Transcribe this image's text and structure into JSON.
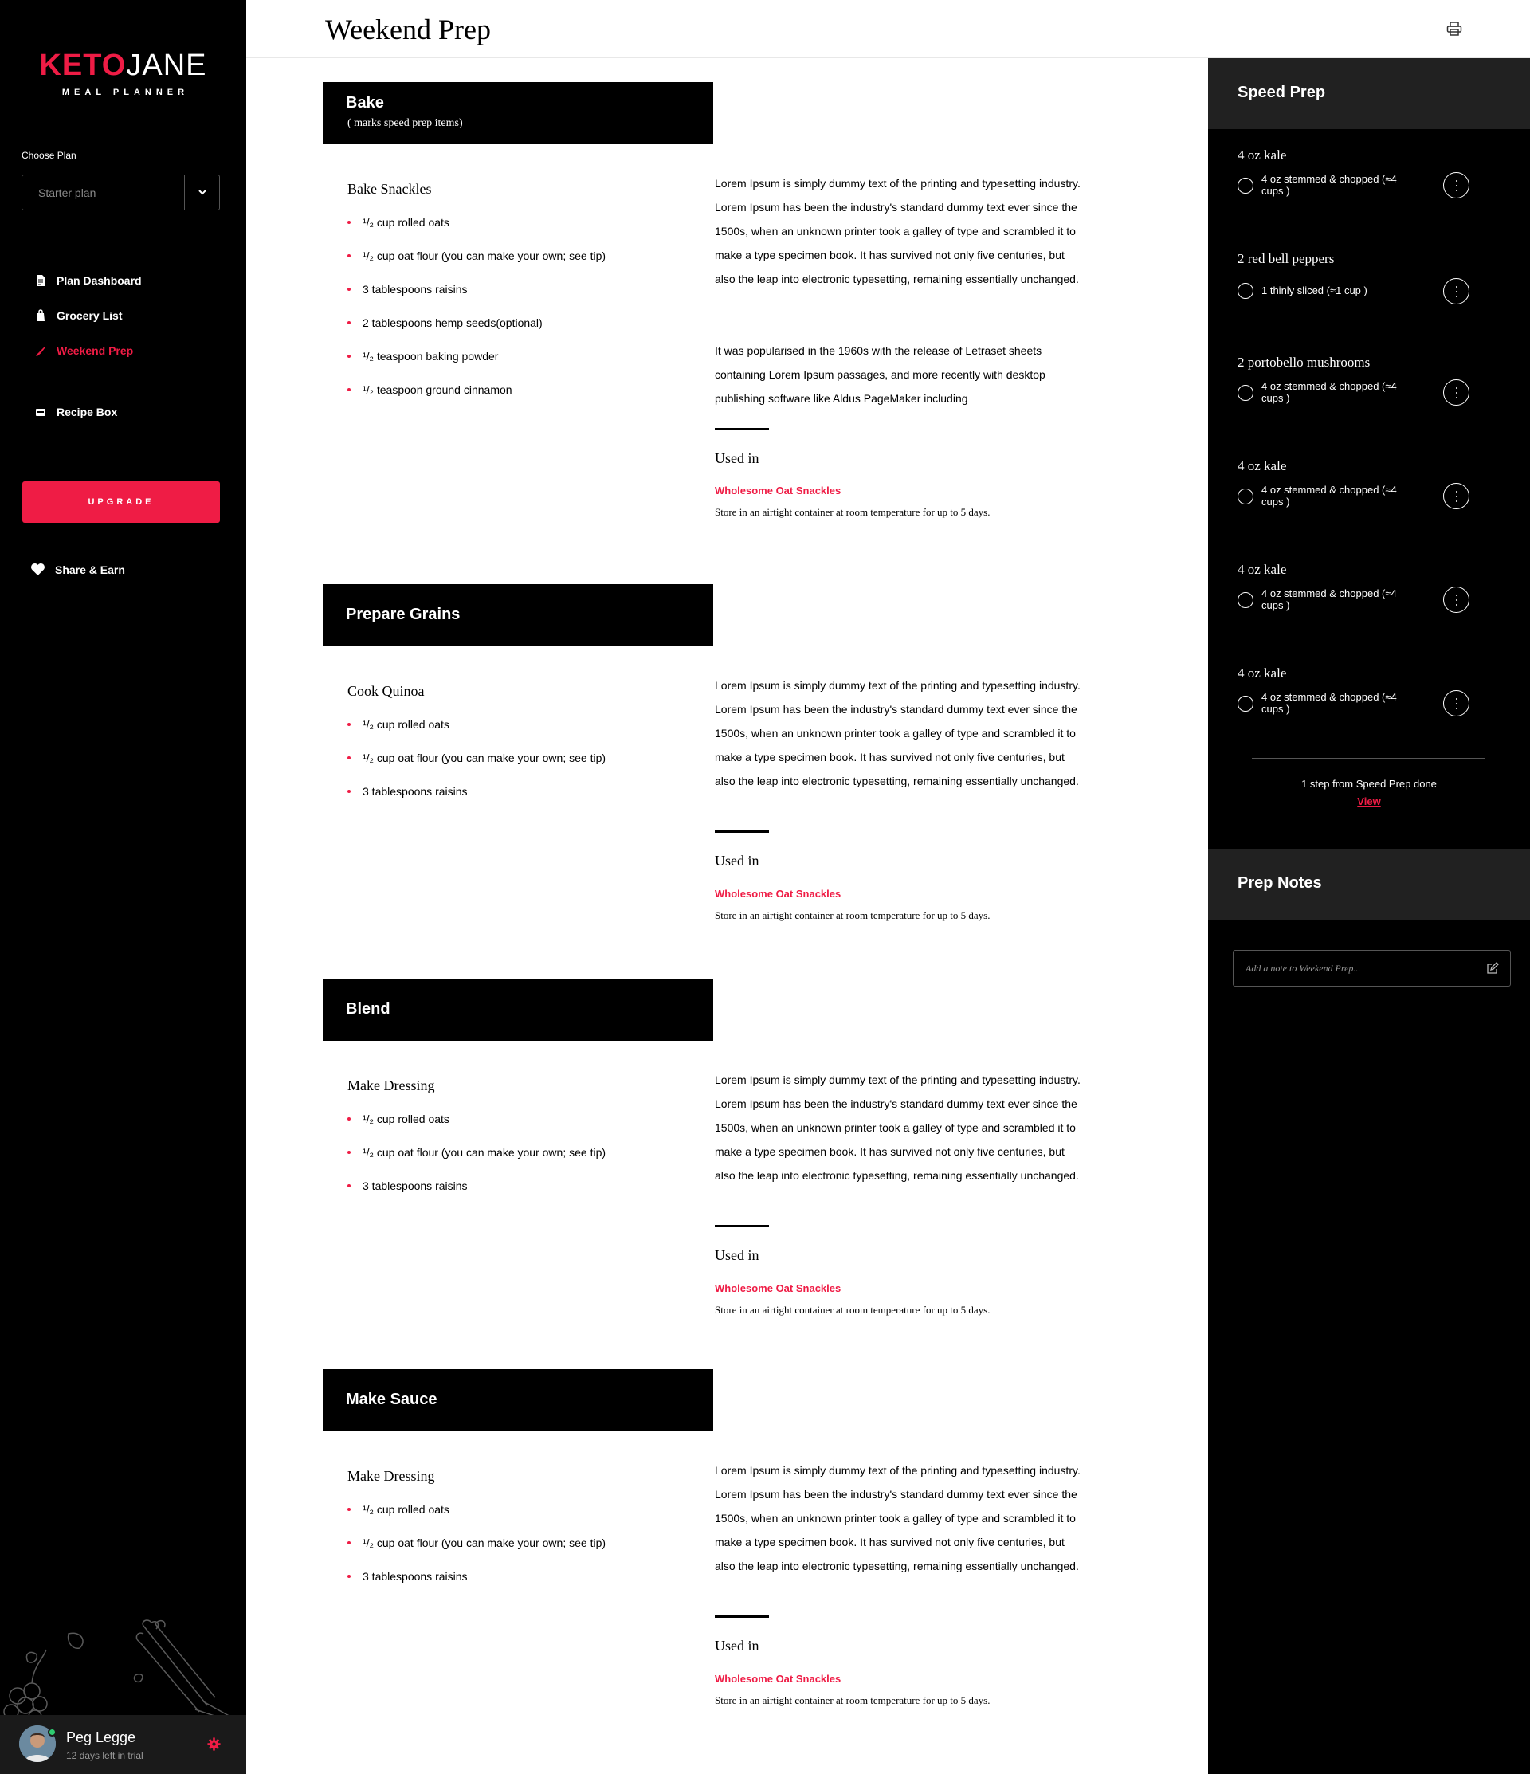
{
  "brand": {
    "name_part1": "KETO",
    "name_part2": "JANE",
    "subtitle": "MEAL PLANNER",
    "accent_color": "#ef1c45"
  },
  "plan": {
    "label": "Choose Plan",
    "placeholder": "Starter plan"
  },
  "nav": {
    "items": [
      {
        "label": "Plan Dashboard",
        "icon": "document-icon"
      },
      {
        "label": "Grocery List",
        "icon": "grocery-bag-icon"
      },
      {
        "label": "Weekend Prep",
        "icon": "knife-icon",
        "active": true
      },
      {
        "label": "Recipe Box",
        "icon": "recipe-box-icon"
      }
    ]
  },
  "upgrade_label": "UPGRADE",
  "share_label": "Share & Earn",
  "user": {
    "name": "Peg Legge",
    "trial": "12 days left in trial"
  },
  "page_title": "Weekend Prep",
  "sections": [
    {
      "title": "Bake",
      "subtitle": "( marks speed prep items)",
      "recipe": "Bake Snackles",
      "ingredients": [
        "¹/₂ cup rolled oats",
        "¹/₂ cup oat flour (you can make your own; see tip)",
        "3 tablespoons raisins",
        "2 tablespoons hemp seeds(optional)",
        "¹/₂ teaspoon baking powder",
        "¹/₂ teaspoon ground cinnamon"
      ],
      "paragraphs": [
        "Lorem Ipsum is simply dummy text of the printing and typesetting industry. Lorem Ipsum has been the industry's standard dummy text ever since the 1500s, when an unknown printer took a galley of type and scrambled it to make a type specimen book. It has survived not only five centuries, but also the leap into electronic typesetting, remaining essentially unchanged.",
        "It was popularised in the 1960s with the release of Letraset sheets containing Lorem Ipsum passages, and more recently with desktop publishing software like Aldus PageMaker including"
      ],
      "used_in_label": "Used in",
      "used_in_link": "Wholesome Oat Snackles",
      "storage_note": "Store in an airtight container at room temperature for up to 5 days."
    },
    {
      "title": "Prepare Grains",
      "recipe": "Cook Quinoa",
      "ingredients": [
        "¹/₂ cup rolled oats",
        "¹/₂ cup oat flour (you can make your own; see tip)",
        "3 tablespoons raisins"
      ],
      "paragraphs": [
        "Lorem Ipsum is simply dummy text of the printing and typesetting industry. Lorem Ipsum has been the industry's standard dummy text ever since the 1500s, when an unknown printer took a galley of type and scrambled it to make a type specimen book. It has survived not only five centuries, but also the leap into electronic typesetting, remaining essentially unchanged."
      ],
      "used_in_label": "Used in",
      "used_in_link": "Wholesome Oat Snackles",
      "storage_note": "Store in an airtight container at room temperature for up to 5 days."
    },
    {
      "title": "Blend",
      "recipe": "Make Dressing",
      "ingredients": [
        "¹/₂ cup rolled oats",
        "¹/₂ cup oat flour (you can make your own; see tip)",
        "3 tablespoons raisins"
      ],
      "paragraphs": [
        "Lorem Ipsum is simply dummy text of the printing and typesetting industry. Lorem Ipsum has been the industry's standard dummy text ever since the 1500s, when an unknown printer took a galley of type and scrambled it to make a type specimen book. It has survived not only five centuries, but also the leap into electronic typesetting, remaining essentially unchanged."
      ],
      "used_in_label": "Used in",
      "used_in_link": "Wholesome Oat Snackles",
      "storage_note": "Store in an airtight container at room temperature for up to 5 days."
    },
    {
      "title": "Make Sauce",
      "recipe": "Make Dressing",
      "ingredients": [
        "¹/₂ cup rolled oats",
        "¹/₂ cup oat flour (you can make your own; see tip)",
        "3 tablespoons raisins"
      ],
      "paragraphs": [
        "Lorem Ipsum is simply dummy text of the printing and typesetting industry. Lorem Ipsum has been the industry's standard dummy text ever since the 1500s, when an unknown printer took a galley of type and scrambled it to make a type specimen book. It has survived not only five centuries, but also the leap into electronic typesetting, remaining essentially unchanged."
      ],
      "used_in_label": "Used in",
      "used_in_link": "Wholesome Oat Snackles",
      "storage_note": "Store in an airtight container at room temperature for up to 5 days."
    }
  ],
  "speed_prep": {
    "title": "Speed Prep",
    "items": [
      {
        "name": "4 oz kale",
        "detail": "4 oz stemmed & chopped (≈4 cups )"
      },
      {
        "name": "2 red bell peppers",
        "detail": "1 thinly sliced (≈1 cup )"
      },
      {
        "name": "2 portobello mushrooms",
        "detail": "4 oz stemmed & chopped (≈4 cups )"
      },
      {
        "name": "4 oz kale",
        "detail": "4 oz stemmed & chopped (≈4 cups )"
      },
      {
        "name": "4 oz kale",
        "detail": "4 oz stemmed & chopped (≈4 cups )"
      },
      {
        "name": "4 oz kale",
        "detail": "4 oz stemmed & chopped (≈4 cups )"
      }
    ],
    "status": "1 step from Speed Prep done",
    "view_label": "View"
  },
  "prep_notes": {
    "title": "Prep Notes",
    "placeholder": "Add a note to Weekend Prep..."
  }
}
